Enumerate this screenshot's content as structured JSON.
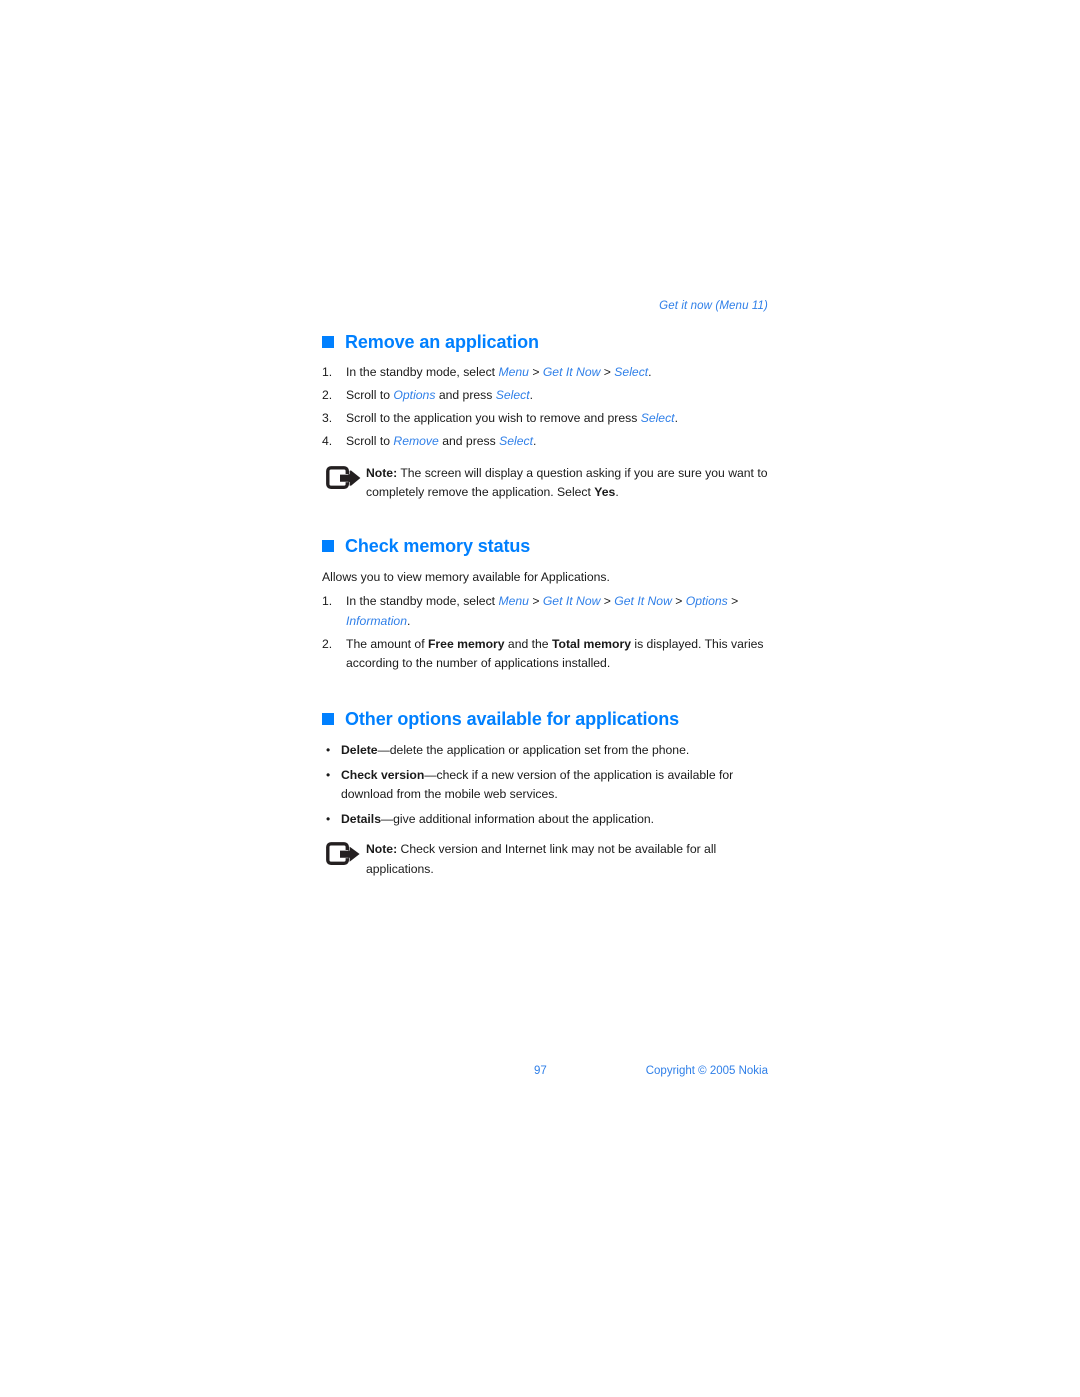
{
  "document": {
    "running_header": "Get it now (Menu 11)",
    "accent_color": "#0080ff",
    "link_color": "#2f7fe8",
    "text_color": "#1a1a1a",
    "background": "#ffffff"
  },
  "sections": {
    "remove": {
      "heading": "Remove an application",
      "steps": [
        {
          "num": "1.",
          "parts": [
            {
              "t": "In the standby mode, select ",
              "s": "plain"
            },
            {
              "t": "Menu",
              "s": "italic"
            },
            {
              "t": " > ",
              "s": "plain"
            },
            {
              "t": "Get It Now",
              "s": "italic"
            },
            {
              "t": " > ",
              "s": "plain"
            },
            {
              "t": "Select",
              "s": "italic"
            },
            {
              "t": ".",
              "s": "plain"
            }
          ]
        },
        {
          "num": "2.",
          "parts": [
            {
              "t": "Scroll to ",
              "s": "plain"
            },
            {
              "t": "Options",
              "s": "italic"
            },
            {
              "t": " and press ",
              "s": "plain"
            },
            {
              "t": "Select",
              "s": "italic"
            },
            {
              "t": ".",
              "s": "plain"
            }
          ]
        },
        {
          "num": "3.",
          "parts": [
            {
              "t": "Scroll to the application you wish to remove and press ",
              "s": "plain"
            },
            {
              "t": "Select",
              "s": "italic"
            },
            {
              "t": ".",
              "s": "plain"
            }
          ]
        },
        {
          "num": "4.",
          "parts": [
            {
              "t": "Scroll to ",
              "s": "plain"
            },
            {
              "t": "Remove",
              "s": "italic"
            },
            {
              "t": " and press ",
              "s": "plain"
            },
            {
              "t": "Select",
              "s": "italic"
            },
            {
              "t": ".",
              "s": "plain"
            }
          ]
        }
      ],
      "note": {
        "icon": "note-arrow-icon",
        "parts": [
          {
            "t": "Note:",
            "s": "bold"
          },
          {
            "t": " The screen will display a question asking if you are sure you want to completely remove the application. Select ",
            "s": "plain"
          },
          {
            "t": "Yes",
            "s": "bold"
          },
          {
            "t": ".",
            "s": "plain"
          }
        ]
      }
    },
    "memory": {
      "heading": "Check memory status",
      "intro": "Allows you to view memory available for Applications.",
      "steps": [
        {
          "num": "1.",
          "parts": [
            {
              "t": "In the standby mode, select ",
              "s": "plain"
            },
            {
              "t": "Menu",
              "s": "italic"
            },
            {
              "t": " > ",
              "s": "plain"
            },
            {
              "t": "Get It Now",
              "s": "italic"
            },
            {
              "t": " > ",
              "s": "plain"
            },
            {
              "t": "Get It Now",
              "s": "italic"
            },
            {
              "t": " > ",
              "s": "plain"
            },
            {
              "t": "Options",
              "s": "italic"
            },
            {
              "t": " > ",
              "s": "plain"
            },
            {
              "t": "Information",
              "s": "italic"
            },
            {
              "t": ".",
              "s": "plain"
            }
          ]
        },
        {
          "num": "2.",
          "parts": [
            {
              "t": "The amount of ",
              "s": "plain"
            },
            {
              "t": "Free memory",
              "s": "bold"
            },
            {
              "t": " and the ",
              "s": "plain"
            },
            {
              "t": "Total memory",
              "s": "bold"
            },
            {
              "t": " is displayed. This varies according to the number of applications installed.",
              "s": "plain"
            }
          ]
        }
      ]
    },
    "other_options": {
      "heading": "Other options available for applications",
      "bullet_char": "•",
      "items": [
        {
          "parts": [
            {
              "t": "Delete",
              "s": "bold"
            },
            {
              "t": "—delete the application or application set from the phone.",
              "s": "plain"
            }
          ]
        },
        {
          "parts": [
            {
              "t": "Check version",
              "s": "bold"
            },
            {
              "t": "—check if a new version of the application is available for download from the mobile web services.",
              "s": "plain"
            }
          ]
        },
        {
          "parts": [
            {
              "t": "Details",
              "s": "bold"
            },
            {
              "t": "—give additional information about the application.",
              "s": "plain"
            }
          ]
        }
      ],
      "note": {
        "icon": "note-arrow-icon",
        "parts": [
          {
            "t": "Note:",
            "s": "bold"
          },
          {
            "t": " Check version and Internet link may not be available for all applications.",
            "s": "plain"
          }
        ]
      }
    }
  },
  "footer": {
    "page_number": "97",
    "copyright": "Copyright © 2005 Nokia"
  }
}
